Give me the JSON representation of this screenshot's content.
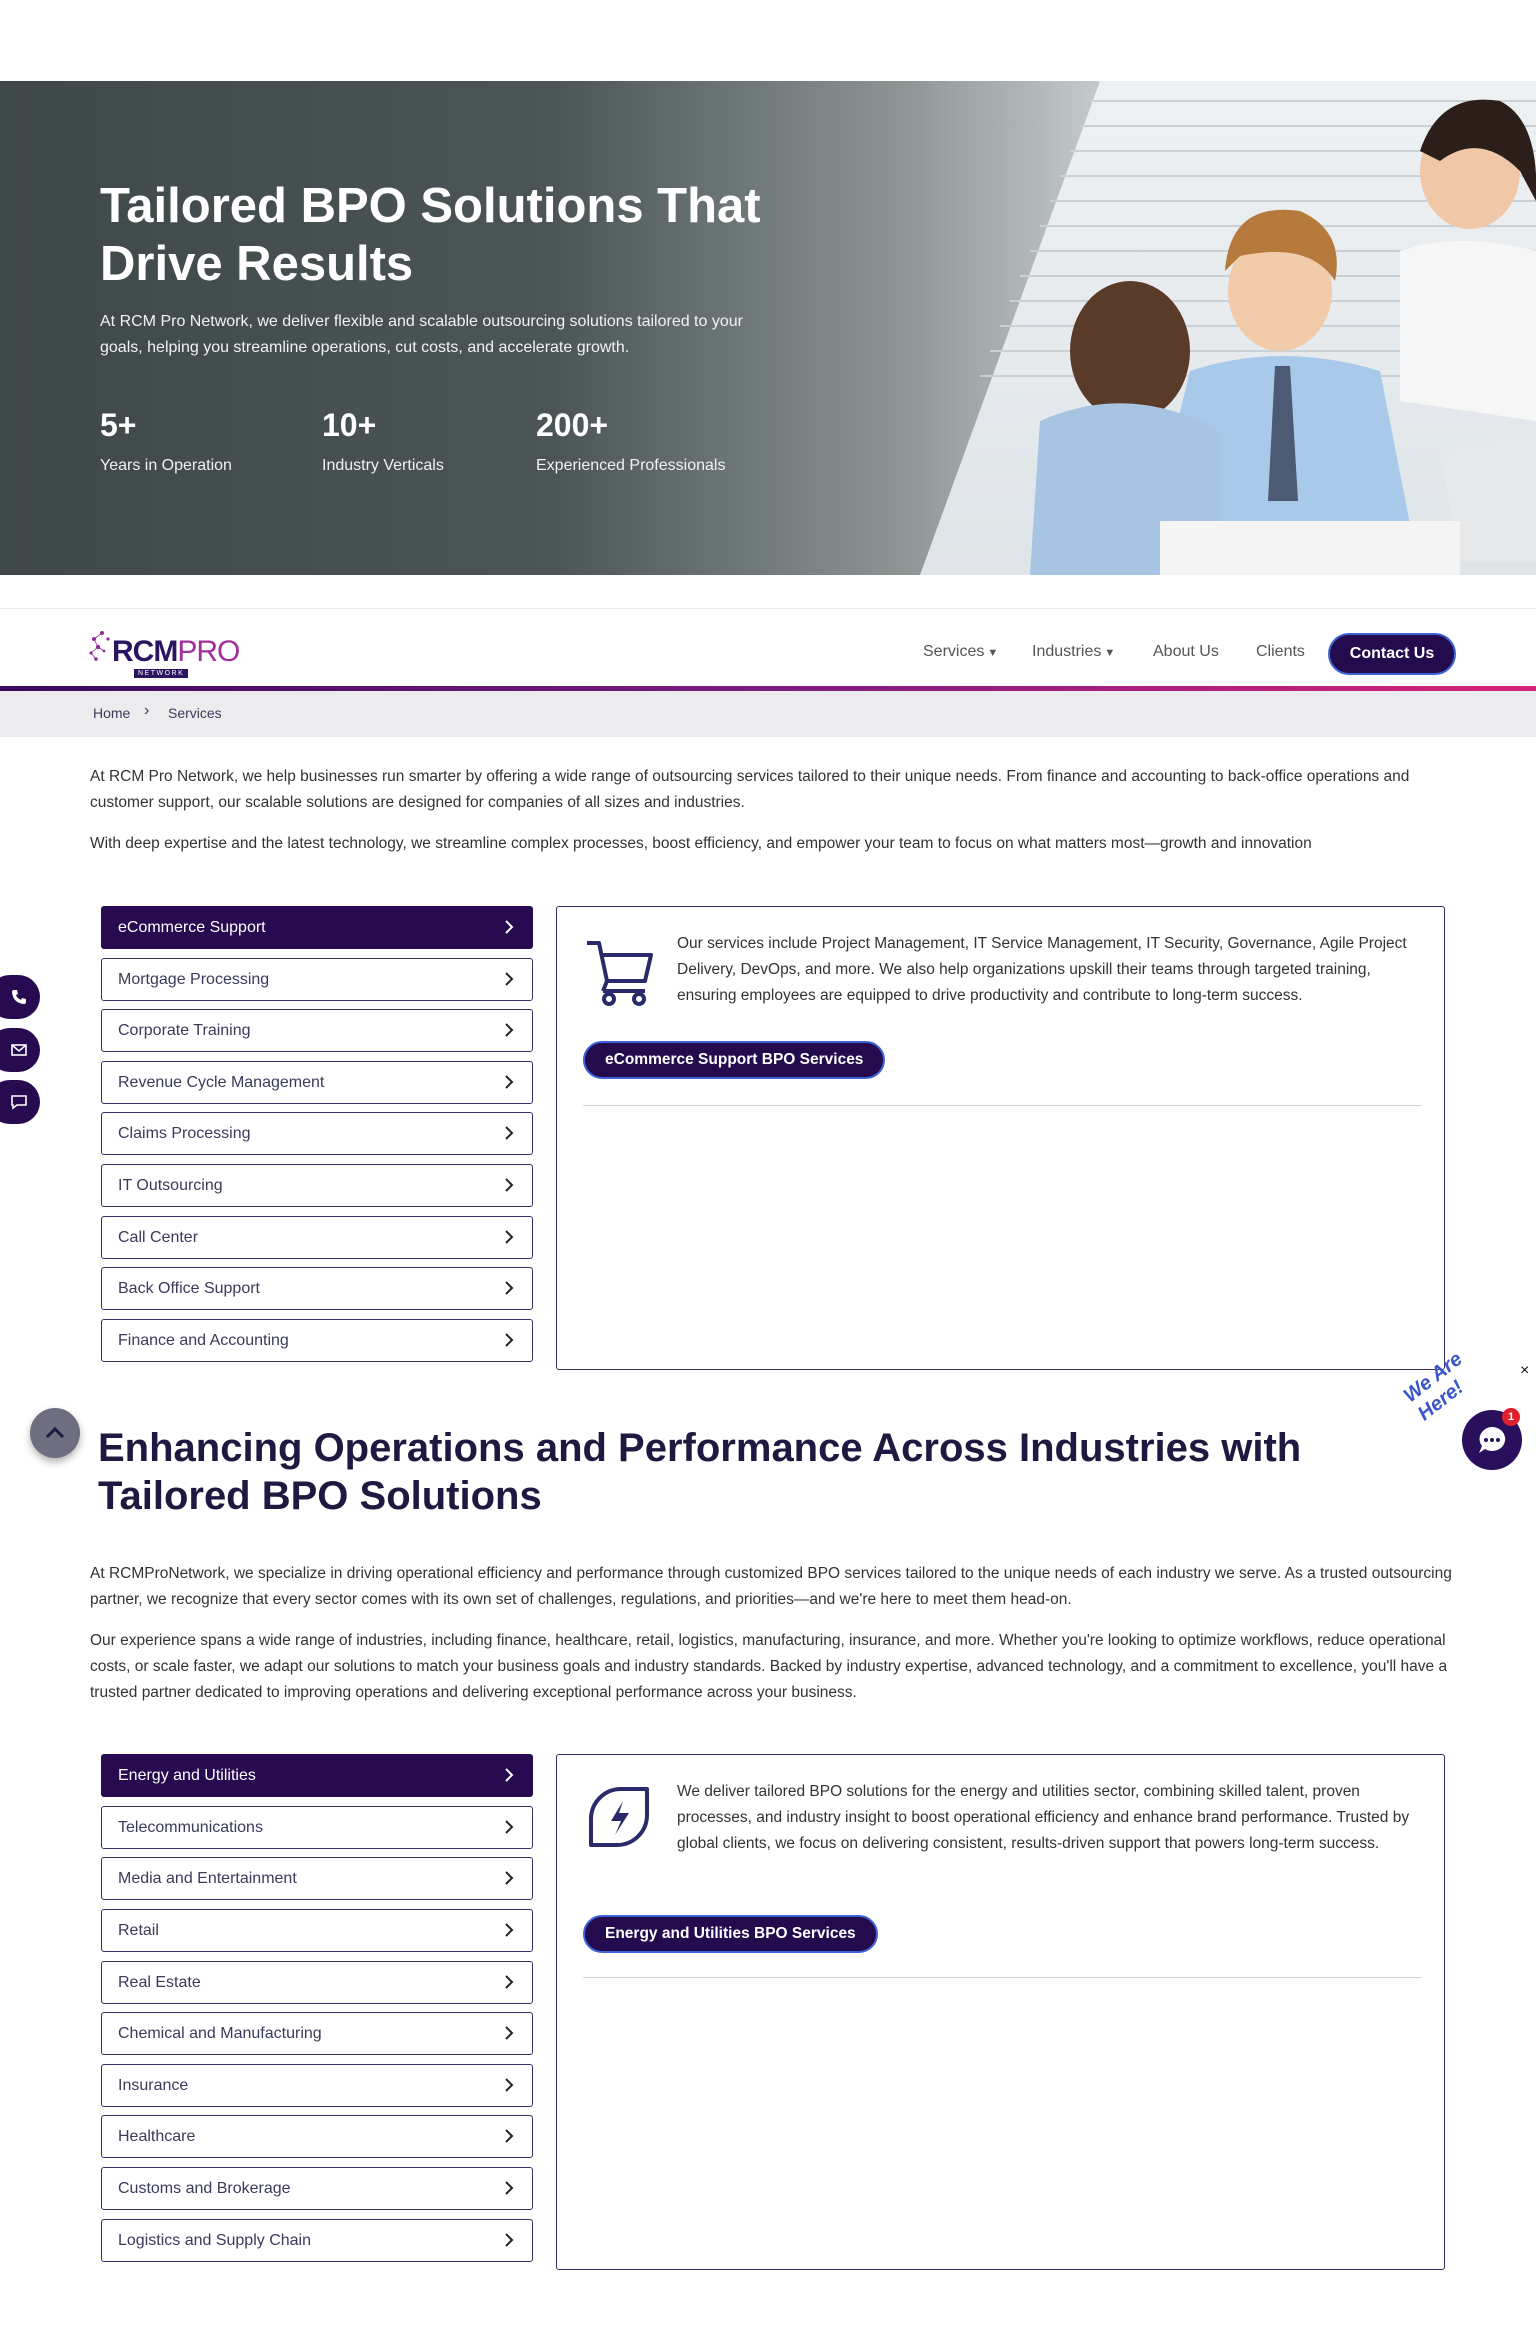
{
  "hero": {
    "title": "Tailored BPO Solutions That Drive Results",
    "subtitle": "At RCM Pro Network, we deliver flexible and scalable outsourcing solutions tailored to your goals, helping you streamline operations, cut costs, and accelerate growth.",
    "stats": [
      {
        "value": "5+",
        "label": "Years in Operation"
      },
      {
        "value": "10+",
        "label": "Industry Verticals"
      },
      {
        "value": "200+",
        "label": "Experienced Professionals"
      }
    ]
  },
  "nav": {
    "logo": {
      "rcm": "RCM",
      "pro": "PRO",
      "network": "NETWORK"
    },
    "items": [
      "Services",
      "Industries",
      "About Us",
      "Clients"
    ],
    "contact": "Contact Us"
  },
  "breadcrumb": {
    "home": "Home",
    "separator": "›",
    "current": "Services"
  },
  "intro": {
    "p1": "At RCM Pro Network, we help businesses run smarter by offering a wide range of outsourcing services tailored to their unique needs. From finance and accounting to back-office operations and customer support, our scalable solutions are designed for companies of all sizes and industries.",
    "p2": "With deep expertise and the latest technology, we streamline complex processes, boost efficiency, and empower your team to focus on what matters most—growth and innovation"
  },
  "services": {
    "items": [
      "eCommerce Support",
      "Mortgage Processing",
      "Corporate Training",
      "Revenue Cycle Management",
      "Claims Processing",
      "IT Outsourcing",
      "Call Center",
      "Back Office Support",
      "Finance and Accounting"
    ],
    "active_index": 0,
    "panel": {
      "icon": "shopping-cart-icon",
      "text": "Our services include Project Management, IT Service Management, IT Security, Governance, Agile Project Delivery, DevOps, and more. We also help organizations upskill their teams through targeted training, ensuring employees are equipped to drive productivity and contribute to long-term success.",
      "button": "eCommerce Support BPO Services"
    }
  },
  "industries_section": {
    "heading": "Enhancing Operations and Performance Across Industries with Tailored BPO Solutions",
    "p1": "At RCMProNetwork, we specialize in driving operational efficiency and performance through customized BPO services tailored to the unique needs of each industry we serve. As a trusted outsourcing partner, we recognize that every sector comes with its own set of challenges, regulations, and priorities—and we're here to meet them head-on.",
    "p2": "Our experience spans a wide range of industries, including finance, healthcare, retail, logistics, manufacturing, insurance, and more. Whether you're looking to optimize workflows, reduce operational costs, or scale faster, we adapt our solutions to match your business goals and industry standards. Backed by industry expertise, advanced technology, and a commitment to excellence, you'll have a trusted partner dedicated to improving operations and delivering exceptional performance across your business."
  },
  "industries": {
    "items": [
      "Energy and Utilities",
      "Telecommunications",
      "Media and Entertainment",
      "Retail",
      "Real Estate",
      "Chemical and Manufacturing",
      "Insurance",
      "Healthcare",
      "Customs and Brokerage",
      "Logistics and Supply Chain"
    ],
    "active_index": 0,
    "panel": {
      "icon": "energy-leaf-icon",
      "text": "We deliver tailored BPO solutions for the energy and utilities sector, combining skilled talent, proven processes, and industry insight to boost operational efficiency and enhance brand performance. Trusted by global clients, we focus on delivering consistent, results-driven support that powers long-term success.",
      "button": "Energy and Utilities BPO Services"
    }
  },
  "chat": {
    "label": "We Are Here!",
    "badge": "1",
    "close": "×"
  },
  "colors": {
    "brand_dark": "#270a4f",
    "accent_blue": "#3d63d6",
    "accent_pink": "#d6247a"
  }
}
